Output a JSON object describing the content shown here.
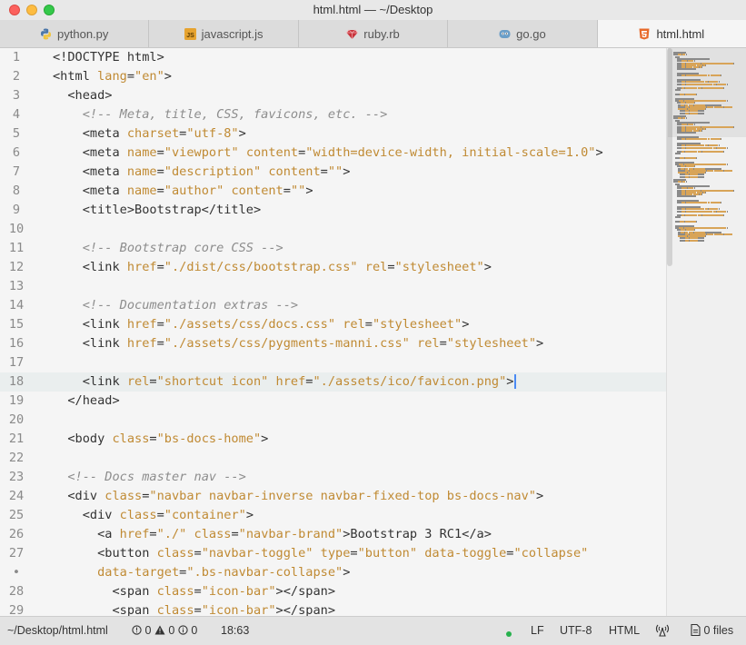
{
  "window": {
    "title": "html.html — ~/Desktop"
  },
  "tabs": [
    {
      "label": "python.py",
      "icon": "python-icon"
    },
    {
      "label": "javascript.js",
      "icon": "js-icon"
    },
    {
      "label": "ruby.rb",
      "icon": "ruby-icon"
    },
    {
      "label": "go.go",
      "icon": "go-icon"
    },
    {
      "label": "html.html",
      "icon": "html5-icon",
      "active": true
    }
  ],
  "editor": {
    "current_line_index": 17,
    "lines": [
      {
        "num": "1",
        "tokens": [
          [
            "n",
            "<!DOCTYPE html>"
          ]
        ]
      },
      {
        "num": "2",
        "tokens": [
          [
            "n",
            "<html "
          ],
          [
            "a",
            "lang"
          ],
          [
            "n",
            "="
          ],
          [
            "a",
            "\"en\""
          ],
          [
            "n",
            ">"
          ]
        ]
      },
      {
        "num": "3",
        "tokens": [
          [
            "n",
            "  <head>"
          ]
        ]
      },
      {
        "num": "4",
        "tokens": [
          [
            "n",
            "    "
          ],
          [
            "c",
            "<!-- Meta, title, CSS, favicons, etc. -->"
          ]
        ]
      },
      {
        "num": "5",
        "tokens": [
          [
            "n",
            "    <meta "
          ],
          [
            "a",
            "charset"
          ],
          [
            "n",
            "="
          ],
          [
            "a",
            "\"utf-8\""
          ],
          [
            "n",
            ">"
          ]
        ]
      },
      {
        "num": "6",
        "tokens": [
          [
            "n",
            "    <meta "
          ],
          [
            "a",
            "name"
          ],
          [
            "n",
            "="
          ],
          [
            "a",
            "\"viewport\""
          ],
          [
            "n",
            " "
          ],
          [
            "a",
            "content"
          ],
          [
            "n",
            "="
          ],
          [
            "a",
            "\"width=device-width, initial-scale=1.0\""
          ],
          [
            "n",
            ">"
          ]
        ]
      },
      {
        "num": "7",
        "tokens": [
          [
            "n",
            "    <meta "
          ],
          [
            "a",
            "name"
          ],
          [
            "n",
            "="
          ],
          [
            "a",
            "\"description\""
          ],
          [
            "n",
            " "
          ],
          [
            "a",
            "content"
          ],
          [
            "n",
            "="
          ],
          [
            "a",
            "\"\""
          ],
          [
            "n",
            ">"
          ]
        ]
      },
      {
        "num": "8",
        "tokens": [
          [
            "n",
            "    <meta "
          ],
          [
            "a",
            "name"
          ],
          [
            "n",
            "="
          ],
          [
            "a",
            "\"author\""
          ],
          [
            "n",
            " "
          ],
          [
            "a",
            "content"
          ],
          [
            "n",
            "="
          ],
          [
            "a",
            "\"\""
          ],
          [
            "n",
            ">"
          ]
        ]
      },
      {
        "num": "9",
        "tokens": [
          [
            "n",
            "    <title>Bootstrap</title>"
          ]
        ]
      },
      {
        "num": "10",
        "tokens": []
      },
      {
        "num": "11",
        "tokens": [
          [
            "n",
            "    "
          ],
          [
            "c",
            "<!-- Bootstrap core CSS -->"
          ]
        ]
      },
      {
        "num": "12",
        "tokens": [
          [
            "n",
            "    <link "
          ],
          [
            "a",
            "href"
          ],
          [
            "n",
            "="
          ],
          [
            "a",
            "\"./dist/css/bootstrap.css\""
          ],
          [
            "n",
            " "
          ],
          [
            "a",
            "rel"
          ],
          [
            "n",
            "="
          ],
          [
            "a",
            "\"stylesheet\""
          ],
          [
            "n",
            ">"
          ]
        ]
      },
      {
        "num": "13",
        "tokens": []
      },
      {
        "num": "14",
        "tokens": [
          [
            "n",
            "    "
          ],
          [
            "c",
            "<!-- Documentation extras -->"
          ]
        ]
      },
      {
        "num": "15",
        "tokens": [
          [
            "n",
            "    <link "
          ],
          [
            "a",
            "href"
          ],
          [
            "n",
            "="
          ],
          [
            "a",
            "\"./assets/css/docs.css\""
          ],
          [
            "n",
            " "
          ],
          [
            "a",
            "rel"
          ],
          [
            "n",
            "="
          ],
          [
            "a",
            "\"stylesheet\""
          ],
          [
            "n",
            ">"
          ]
        ]
      },
      {
        "num": "16",
        "tokens": [
          [
            "n",
            "    <link "
          ],
          [
            "a",
            "href"
          ],
          [
            "n",
            "="
          ],
          [
            "a",
            "\"./assets/css/pygments-manni.css\""
          ],
          [
            "n",
            " "
          ],
          [
            "a",
            "rel"
          ],
          [
            "n",
            "="
          ],
          [
            "a",
            "\"stylesheet\""
          ],
          [
            "n",
            ">"
          ]
        ]
      },
      {
        "num": "17",
        "tokens": []
      },
      {
        "num": "18",
        "tokens": [
          [
            "n",
            "    <link "
          ],
          [
            "a",
            "rel"
          ],
          [
            "n",
            "="
          ],
          [
            "a",
            "\"shortcut icon\""
          ],
          [
            "n",
            " "
          ],
          [
            "a",
            "href"
          ],
          [
            "n",
            "="
          ],
          [
            "a",
            "\"./assets/ico/favicon.png\""
          ],
          [
            "n",
            ">"
          ]
        ]
      },
      {
        "num": "19",
        "tokens": [
          [
            "n",
            "  </head>"
          ]
        ]
      },
      {
        "num": "20",
        "tokens": []
      },
      {
        "num": "21",
        "tokens": [
          [
            "n",
            "  <body "
          ],
          [
            "a",
            "class"
          ],
          [
            "n",
            "="
          ],
          [
            "a",
            "\"bs-docs-home\""
          ],
          [
            "n",
            ">"
          ]
        ]
      },
      {
        "num": "22",
        "tokens": []
      },
      {
        "num": "23",
        "tokens": [
          [
            "n",
            "  "
          ],
          [
            "c",
            "<!-- Docs master nav -->"
          ]
        ]
      },
      {
        "num": "24",
        "tokens": [
          [
            "n",
            "  <div "
          ],
          [
            "a",
            "class"
          ],
          [
            "n",
            "="
          ],
          [
            "a",
            "\"navbar navbar-inverse navbar-fixed-top bs-docs-nav\""
          ],
          [
            "n",
            ">"
          ]
        ]
      },
      {
        "num": "25",
        "tokens": [
          [
            "n",
            "    <div "
          ],
          [
            "a",
            "class"
          ],
          [
            "n",
            "="
          ],
          [
            "a",
            "\"container\""
          ],
          [
            "n",
            ">"
          ]
        ]
      },
      {
        "num": "26",
        "tokens": [
          [
            "n",
            "      <a "
          ],
          [
            "a",
            "href"
          ],
          [
            "n",
            "="
          ],
          [
            "a",
            "\"./\""
          ],
          [
            "n",
            " "
          ],
          [
            "a",
            "class"
          ],
          [
            "n",
            "="
          ],
          [
            "a",
            "\"navbar-brand\""
          ],
          [
            "n",
            ">Bootstrap 3 RC1</a>"
          ]
        ]
      },
      {
        "num": "27",
        "tokens": [
          [
            "n",
            "      <button "
          ],
          [
            "a",
            "class"
          ],
          [
            "n",
            "="
          ],
          [
            "a",
            "\"navbar-toggle\""
          ],
          [
            "n",
            " "
          ],
          [
            "a",
            "type"
          ],
          [
            "n",
            "="
          ],
          [
            "a",
            "\"button\""
          ],
          [
            "n",
            " "
          ],
          [
            "a",
            "data-toggle"
          ],
          [
            "n",
            "="
          ],
          [
            "a",
            "\"collapse\""
          ]
        ]
      },
      {
        "num": "•",
        "tokens": [
          [
            "n",
            "      "
          ],
          [
            "a",
            "data-target"
          ],
          [
            "n",
            "="
          ],
          [
            "a",
            "\".bs-navbar-collapse\""
          ],
          [
            "n",
            ">"
          ]
        ]
      },
      {
        "num": "28",
        "tokens": [
          [
            "n",
            "        <span "
          ],
          [
            "a",
            "class"
          ],
          [
            "n",
            "="
          ],
          [
            "a",
            "\"icon-bar\""
          ],
          [
            "n",
            "></span>"
          ]
        ]
      },
      {
        "num": "29",
        "tokens": [
          [
            "n",
            "        <span "
          ],
          [
            "a",
            "class"
          ],
          [
            "n",
            "="
          ],
          [
            "a",
            "\"icon-bar\""
          ],
          [
            "n",
            "></span>"
          ]
        ]
      }
    ]
  },
  "status": {
    "path": "~/Desktop/html.html",
    "errors": "0",
    "warnings": "0",
    "infos": "0",
    "cursor_pos": "18:63",
    "line_ending": "LF",
    "encoding": "UTF-8",
    "grammar": "HTML",
    "files": "0 files",
    "git_dot_color": "#27b14d"
  },
  "colors": {
    "attr": "#c08a33",
    "comment": "#8d8d8d",
    "text": "#333333",
    "cursor": "#4a8af4"
  }
}
